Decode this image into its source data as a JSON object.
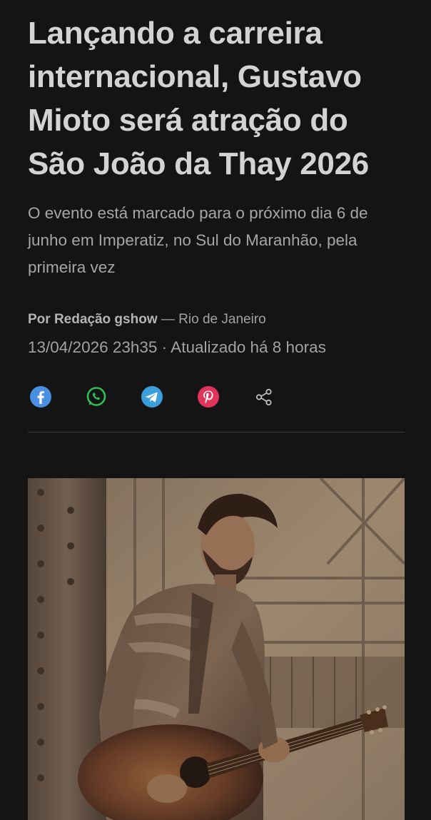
{
  "article": {
    "headline": "Lançando a carreira internacional, Gustavo Mioto será atração do São João da Thay 2026",
    "subtitle": "O evento está marcado para o próximo dia 6 de junho em Imperatiz, no Sul do Maranhão, pela primeira vez",
    "byline": {
      "author": "Por Redação gshow",
      "separator": " — ",
      "location": "Rio de Janeiro"
    },
    "dateline": "13/04/2026 23h35 · Atualizado há 8 horas"
  },
  "share": {
    "buttons": [
      {
        "icon": "facebook-icon",
        "color": "#4a90e2"
      },
      {
        "icon": "whatsapp-icon",
        "color": "#2fbf55"
      },
      {
        "icon": "telegram-icon",
        "color": "#3a9fdb"
      },
      {
        "icon": "pinterest-icon",
        "color": "#e0345a"
      },
      {
        "icon": "share-icon",
        "color": "#bdbdbd"
      }
    ]
  },
  "photo": {
    "subject": "man-playing-acoustic-guitar"
  }
}
